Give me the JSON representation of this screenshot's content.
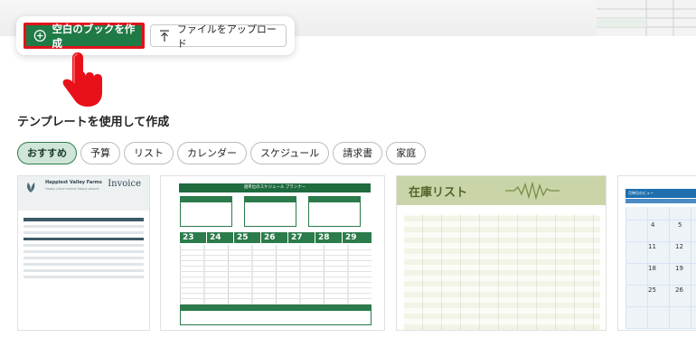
{
  "actions": {
    "create_blank": "空白のブックを作成",
    "upload_file": "ファイルをアップロード"
  },
  "section_title": "テンプレートを使用して作成",
  "categories": [
    "おすすめ",
    "予算",
    "リスト",
    "カレンダー",
    "スケジュール",
    "請求書",
    "家庭"
  ],
  "templates": {
    "invoice": {
      "company": "Happiest Valley Farms",
      "tagline": "Happy place means happy people",
      "title": "Invoice"
    },
    "schedule": {
      "title": "週単位のスケジュール プランナー",
      "days": [
        "23",
        "24",
        "25",
        "26",
        "27",
        "28",
        "29"
      ]
    },
    "inventory": {
      "title": "在庫リスト"
    },
    "calendar": {
      "title": "月単位のビュー",
      "dates": [
        "4",
        "5",
        "11",
        "12",
        "18",
        "19",
        "25",
        "26"
      ]
    }
  },
  "icons": {
    "plus": "plus-circle-icon",
    "upload": "upload-arrow-icon",
    "cursor": "pointing-hand-icon"
  },
  "colors": {
    "primary_green": "#1f7a45",
    "highlight_red": "#e0131b",
    "chip_active_bg": "#cfe5d7"
  }
}
